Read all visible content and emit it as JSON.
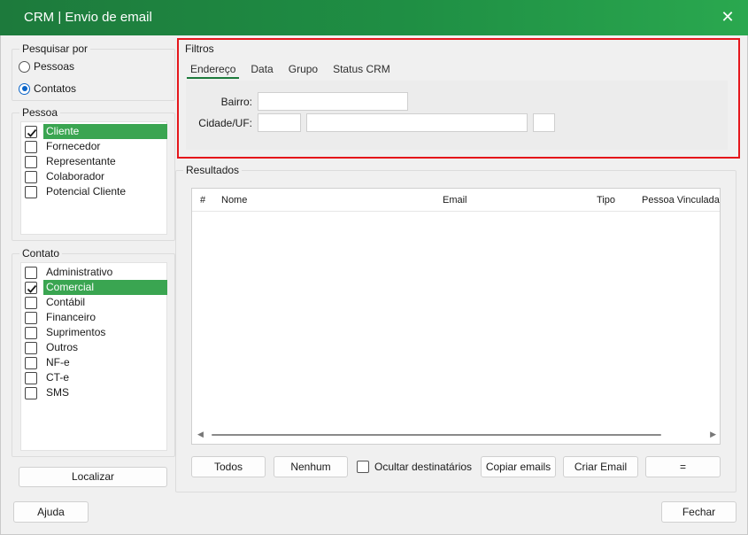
{
  "window": {
    "title": "CRM | Envio de email",
    "close_glyph": "✕"
  },
  "search_by": {
    "legend": "Pesquisar por",
    "options": [
      {
        "label": "Pessoas",
        "selected": false
      },
      {
        "label": "Contatos",
        "selected": true
      }
    ]
  },
  "pessoa": {
    "legend": "Pessoa",
    "items": [
      {
        "label": "Cliente",
        "checked": true
      },
      {
        "label": "Fornecedor",
        "checked": false
      },
      {
        "label": "Representante",
        "checked": false
      },
      {
        "label": "Colaborador",
        "checked": false
      },
      {
        "label": "Potencial Cliente",
        "checked": false
      }
    ]
  },
  "contato": {
    "legend": "Contato",
    "items": [
      {
        "label": "Administrativo",
        "checked": false
      },
      {
        "label": "Comercial",
        "checked": true
      },
      {
        "label": "Contábil",
        "checked": false
      },
      {
        "label": "Financeiro",
        "checked": false
      },
      {
        "label": "Suprimentos",
        "checked": false
      },
      {
        "label": "Outros",
        "checked": false
      },
      {
        "label": "NF-e",
        "checked": false
      },
      {
        "label": "CT-e",
        "checked": false
      },
      {
        "label": "SMS",
        "checked": false
      }
    ]
  },
  "buttons": {
    "localizar": "Localizar",
    "ajuda": "Ajuda",
    "fechar": "Fechar",
    "todos": "Todos",
    "nenhum": "Nenhum",
    "copiar_emails": "Copiar emails",
    "criar_email": "Criar Email",
    "equals": "="
  },
  "filtros": {
    "legend": "Filtros",
    "tabs": [
      "Endereço",
      "Data",
      "Grupo",
      "Status CRM"
    ],
    "active_tab": "Endereço",
    "bairro_label": "Bairro:",
    "bairro_value": "",
    "cidade_uf_label": "Cidade/UF:",
    "cidade_code_value": "",
    "cidade_name_value": "",
    "uf_value": ""
  },
  "resultados": {
    "legend": "Resultados",
    "columns": [
      "#",
      "Nome",
      "Email",
      "Tipo",
      "Pessoa Vinculada"
    ],
    "rows": [],
    "ocultar_label": "Ocultar destinatários",
    "ocultar_checked": false
  },
  "colors": {
    "titlebar_start": "#1d7a3c",
    "titlebar_end": "#2aa84f",
    "selection": "#3aa551",
    "highlight": "#e5171c",
    "radio_accent": "#0a64c8"
  }
}
